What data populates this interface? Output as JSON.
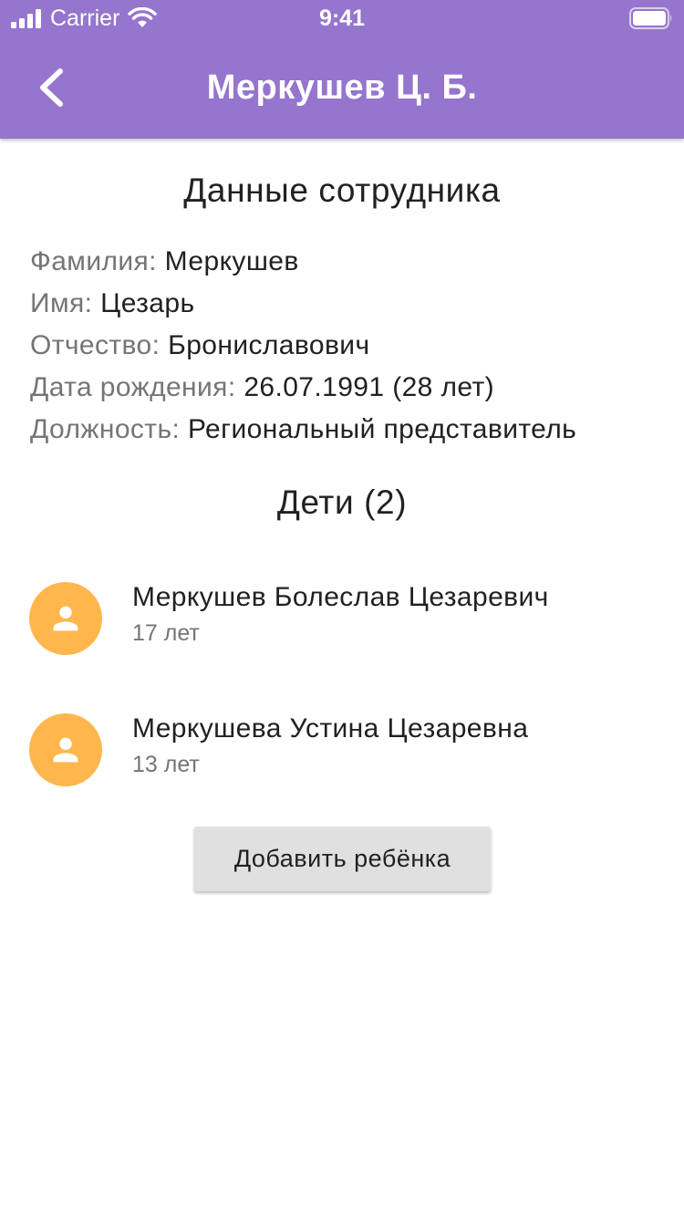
{
  "status_bar": {
    "carrier": "Carrier",
    "time": "9:41"
  },
  "header": {
    "title": "Меркушев Ц. Б.",
    "back_icon": "chevron-left-icon",
    "background_color": "#9575cd"
  },
  "employee": {
    "section_title": "Данные сотрудника",
    "fields": [
      {
        "label": "Фамилия:",
        "value": "Меркушев"
      },
      {
        "label": "Имя:",
        "value": "Цезарь"
      },
      {
        "label": "Отчество:",
        "value": "Брониславович"
      },
      {
        "label": "Дата рождения:",
        "value": "26.07.1991 (28 лет)"
      },
      {
        "label": "Должность:",
        "value": "Региональный представитель"
      }
    ]
  },
  "children": {
    "section_title": "Дети (2)",
    "avatar_color": "#ffb74d",
    "avatar_icon": "person-icon",
    "items": [
      {
        "name": "Меркушев Болеслав Цезаревич",
        "age": "17 лет"
      },
      {
        "name": "Меркушева Устина Цезаревна",
        "age": "13 лет"
      }
    ]
  },
  "actions": {
    "add_child_label": "Добавить ребёнка"
  }
}
